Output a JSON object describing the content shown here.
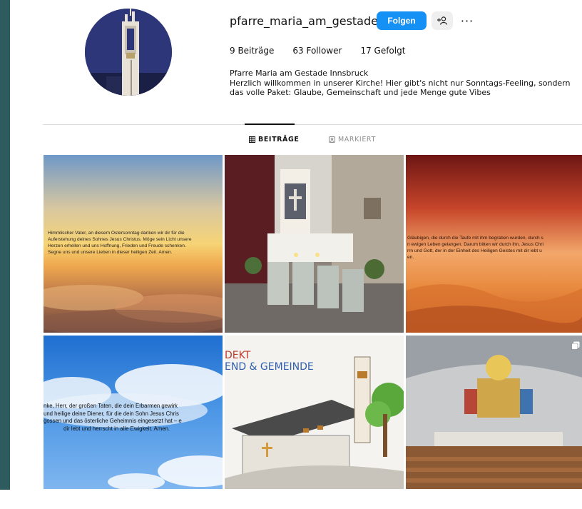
{
  "profile": {
    "username": "pfarre_maria_am_gestade",
    "follow_label": "Folgen",
    "suggest_icon": "add-person-icon",
    "more_label": "···",
    "stats": {
      "posts": "9 Beiträge",
      "followers": "63 Follower",
      "following": "17 Gefolgt"
    },
    "bio": {
      "name": "Pfarre Maria am Gestade Innsbruck",
      "line1": "Herzlich willkommen in unserer Kirche! Hier gibt's nicht nur Sonntags-Feeling, sondern",
      "line2": "das volle Paket: Glaube, Gemeinschaft und jede Menge gute Vibes"
    }
  },
  "tabs": [
    {
      "label": "BEITRÄGE",
      "icon": "grid-icon",
      "active": true
    },
    {
      "label": "MARKIERT",
      "icon": "tagged-icon",
      "active": false
    }
  ],
  "posts": {
    "p1": {
      "l1": "Himmlischer Vater, an diesem Ostersonntag danken wir dir für die",
      "l2": "Auferstehung deines Sohnes Jesus Christus. Möge sein Licht unsere",
      "l3": "Herzen erhellen und uns Hoffnung, Frieden und Freude schenken.",
      "l4": "Segne uns und unsere Lieben in dieser heiligen Zeit. Amen."
    },
    "p3": {
      "l1": "Gläubigen, die durch die Taufe mit ihm begraben wurden, durch s",
      "l2": "n ewigen Leben gelangen. Darum bitten wir durch ihn, Jesus Chri",
      "l3": "rrn und Gott, der in der Einheit des Heiligen Geistes mit dir lebt u",
      "l4": "en."
    },
    "p4": {
      "l1": "nke, Herr, der großen Taten, die dein Erbarmen gewirk",
      "l2": "und heilige deine Diener, für die dein Sohn Jesus Chris",
      "l3": "gossen und das österliche Geheimnis eingesetzt hat – e",
      "l4": "dir lebt und herrscht in alle Ewigkeit. Amen."
    },
    "p5": {
      "l1": "DEKT",
      "l2": "END & GEMEINDE"
    },
    "p6": {
      "badge_icon": "multi-image-icon"
    }
  },
  "colors": {
    "follow_button": "#1590f5",
    "frame": "#2b5a5e"
  }
}
